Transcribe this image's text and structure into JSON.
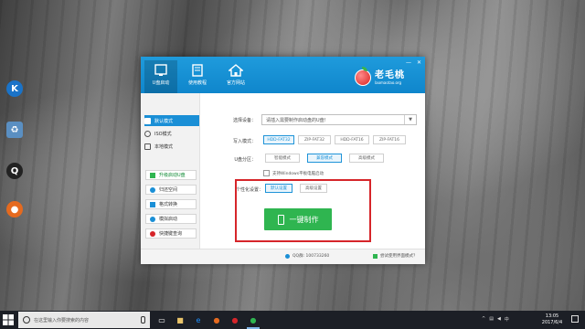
{
  "desktop_icons": [
    {
      "name": "k-app",
      "glyph": "K",
      "color": "#1a73c8"
    },
    {
      "name": "recycle-bin",
      "glyph": "♻",
      "color": "#5a8fc2"
    },
    {
      "name": "qq-app",
      "glyph": "Q",
      "color": "#222222"
    },
    {
      "name": "laomaotao-app",
      "glyph": "●",
      "color": "#e56a1f"
    }
  ],
  "app": {
    "header_tabs": [
      {
        "label": "U盘启动",
        "icon": "usb-drive-icon"
      },
      {
        "label": "使用教程",
        "icon": "book-icon"
      },
      {
        "label": "官方网站",
        "icon": "home-icon"
      }
    ],
    "logo": {
      "title": "老毛桃",
      "subtitle": "laomaotao.org"
    },
    "sidebar": {
      "modes": [
        {
          "label": "默认模式",
          "icon": "usb-icon",
          "active": true
        },
        {
          "label": "ISO模式",
          "icon": "disc-icon",
          "active": false
        },
        {
          "label": "本地模式",
          "icon": "monitor-icon",
          "active": false
        }
      ],
      "buttons": [
        {
          "label": "升级启动U盘",
          "icon": "upgrade-icon",
          "accent": true
        },
        {
          "label": "归还空间",
          "icon": "refresh-icon",
          "accent": false
        },
        {
          "label": "格式转换",
          "icon": "convert-icon",
          "accent": false
        },
        {
          "label": "模拟启动",
          "icon": "simulate-icon",
          "accent": false
        },
        {
          "label": "快捷键查询",
          "icon": "search-icon",
          "accent": false
        }
      ]
    },
    "form": {
      "device_label": "选择设备：",
      "device_value": "请插入需要制作启动盘的U盘!",
      "write_label": "写入模式：",
      "write_options": [
        "HDD-FAT32",
        "ZIP-FAT32",
        "HDD-FAT16",
        "ZIP-FAT16"
      ],
      "write_selected": 0,
      "partition_label": "U盘分区：",
      "partition_options": [
        "智能模式",
        "兼容模式",
        "高级模式"
      ],
      "partition_selected": 1,
      "checkbox_label": "支持Windows平板电脑启动",
      "personal_label": "个性化设置：",
      "personal_options": [
        "默认设置",
        "高级设置"
      ],
      "personal_selected": 0,
      "make_button": "一键制作"
    },
    "footer": {
      "qq": "QQ群: 100733260",
      "try": "尝试使用界面模式？"
    }
  },
  "taskbar": {
    "search_placeholder": "在这里输入你要搜索的内容",
    "time": "13:05",
    "date": "2017/6/4"
  }
}
